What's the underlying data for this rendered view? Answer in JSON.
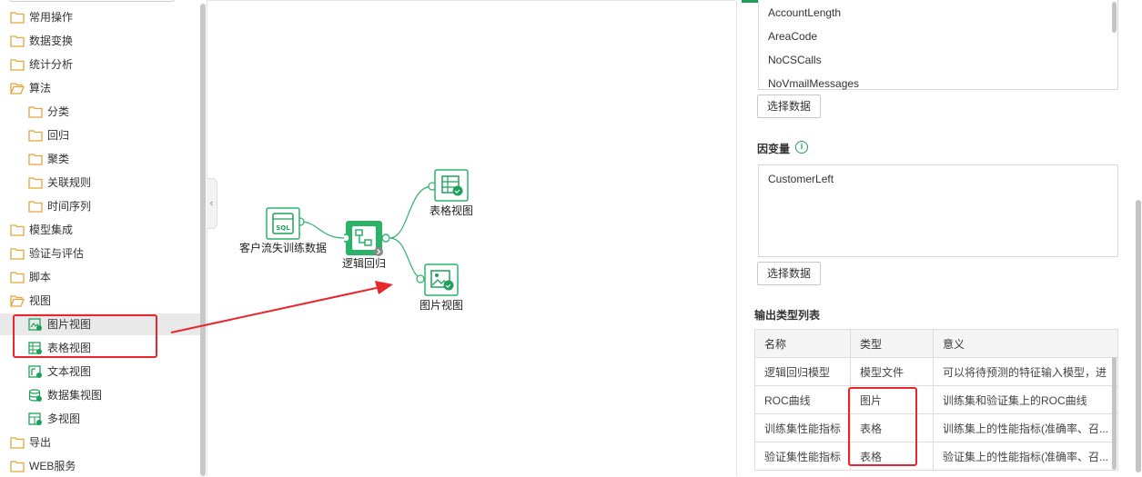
{
  "sidebar": {
    "items": [
      {
        "label": "常用操作",
        "type": "folder"
      },
      {
        "label": "数据变换",
        "type": "folder"
      },
      {
        "label": "统计分析",
        "type": "folder"
      },
      {
        "label": "算法",
        "type": "folder-open"
      },
      {
        "label": "分类",
        "type": "folder"
      },
      {
        "label": "回归",
        "type": "folder"
      },
      {
        "label": "聚类",
        "type": "folder"
      },
      {
        "label": "关联规则",
        "type": "folder"
      },
      {
        "label": "时间序列",
        "type": "folder"
      },
      {
        "label": "模型集成",
        "type": "folder"
      },
      {
        "label": "验证与评估",
        "type": "folder"
      },
      {
        "label": "脚本",
        "type": "folder"
      },
      {
        "label": "视图",
        "type": "folder-open"
      },
      {
        "label": "图片视图",
        "type": "image-view-icon"
      },
      {
        "label": "表格视图",
        "type": "table-view-icon"
      },
      {
        "label": "文本视图",
        "type": "text-view-icon"
      },
      {
        "label": "数据集视图",
        "type": "dataset-view-icon"
      },
      {
        "label": "多视图",
        "type": "multi-view-icon"
      },
      {
        "label": "导出",
        "type": "folder"
      },
      {
        "label": "WEB服务",
        "type": "folder"
      }
    ]
  },
  "canvas": {
    "collapse_glyph": "‹",
    "nodes": {
      "sql": "客户流失训练数据",
      "logistic": "逻辑回归",
      "table_view": "表格视图",
      "image_view": "图片视图"
    },
    "sql_badge": "SQL"
  },
  "props": {
    "independent_vars": [
      "AccountLength",
      "AreaCode",
      "NoCSCalls",
      "NoVmailMessages"
    ],
    "select_data_1": "选择数据",
    "dependent_title": "因变量",
    "info_glyph": "i",
    "dependent_value": "CustomerLeft",
    "select_data_2": "选择数据",
    "output_title": "输出类型列表",
    "table": {
      "headers": [
        "名称",
        "类型",
        "意义"
      ],
      "rows": [
        [
          "逻辑回归模型",
          "模型文件",
          "可以将待预测的特征输入模型，进"
        ],
        [
          "ROC曲线",
          "图片",
          "训练集和验证集上的ROC曲线"
        ],
        [
          "训练集性能指标",
          "表格",
          "训练集上的性能指标(准确率、召..."
        ],
        [
          "验证集性能指标",
          "表格",
          "验证集上的性能指标(准确率、召..."
        ]
      ]
    }
  },
  "colors": {
    "accent": "#1fa05a",
    "annotation": "#e8262b",
    "folder": "#e8a33c"
  }
}
